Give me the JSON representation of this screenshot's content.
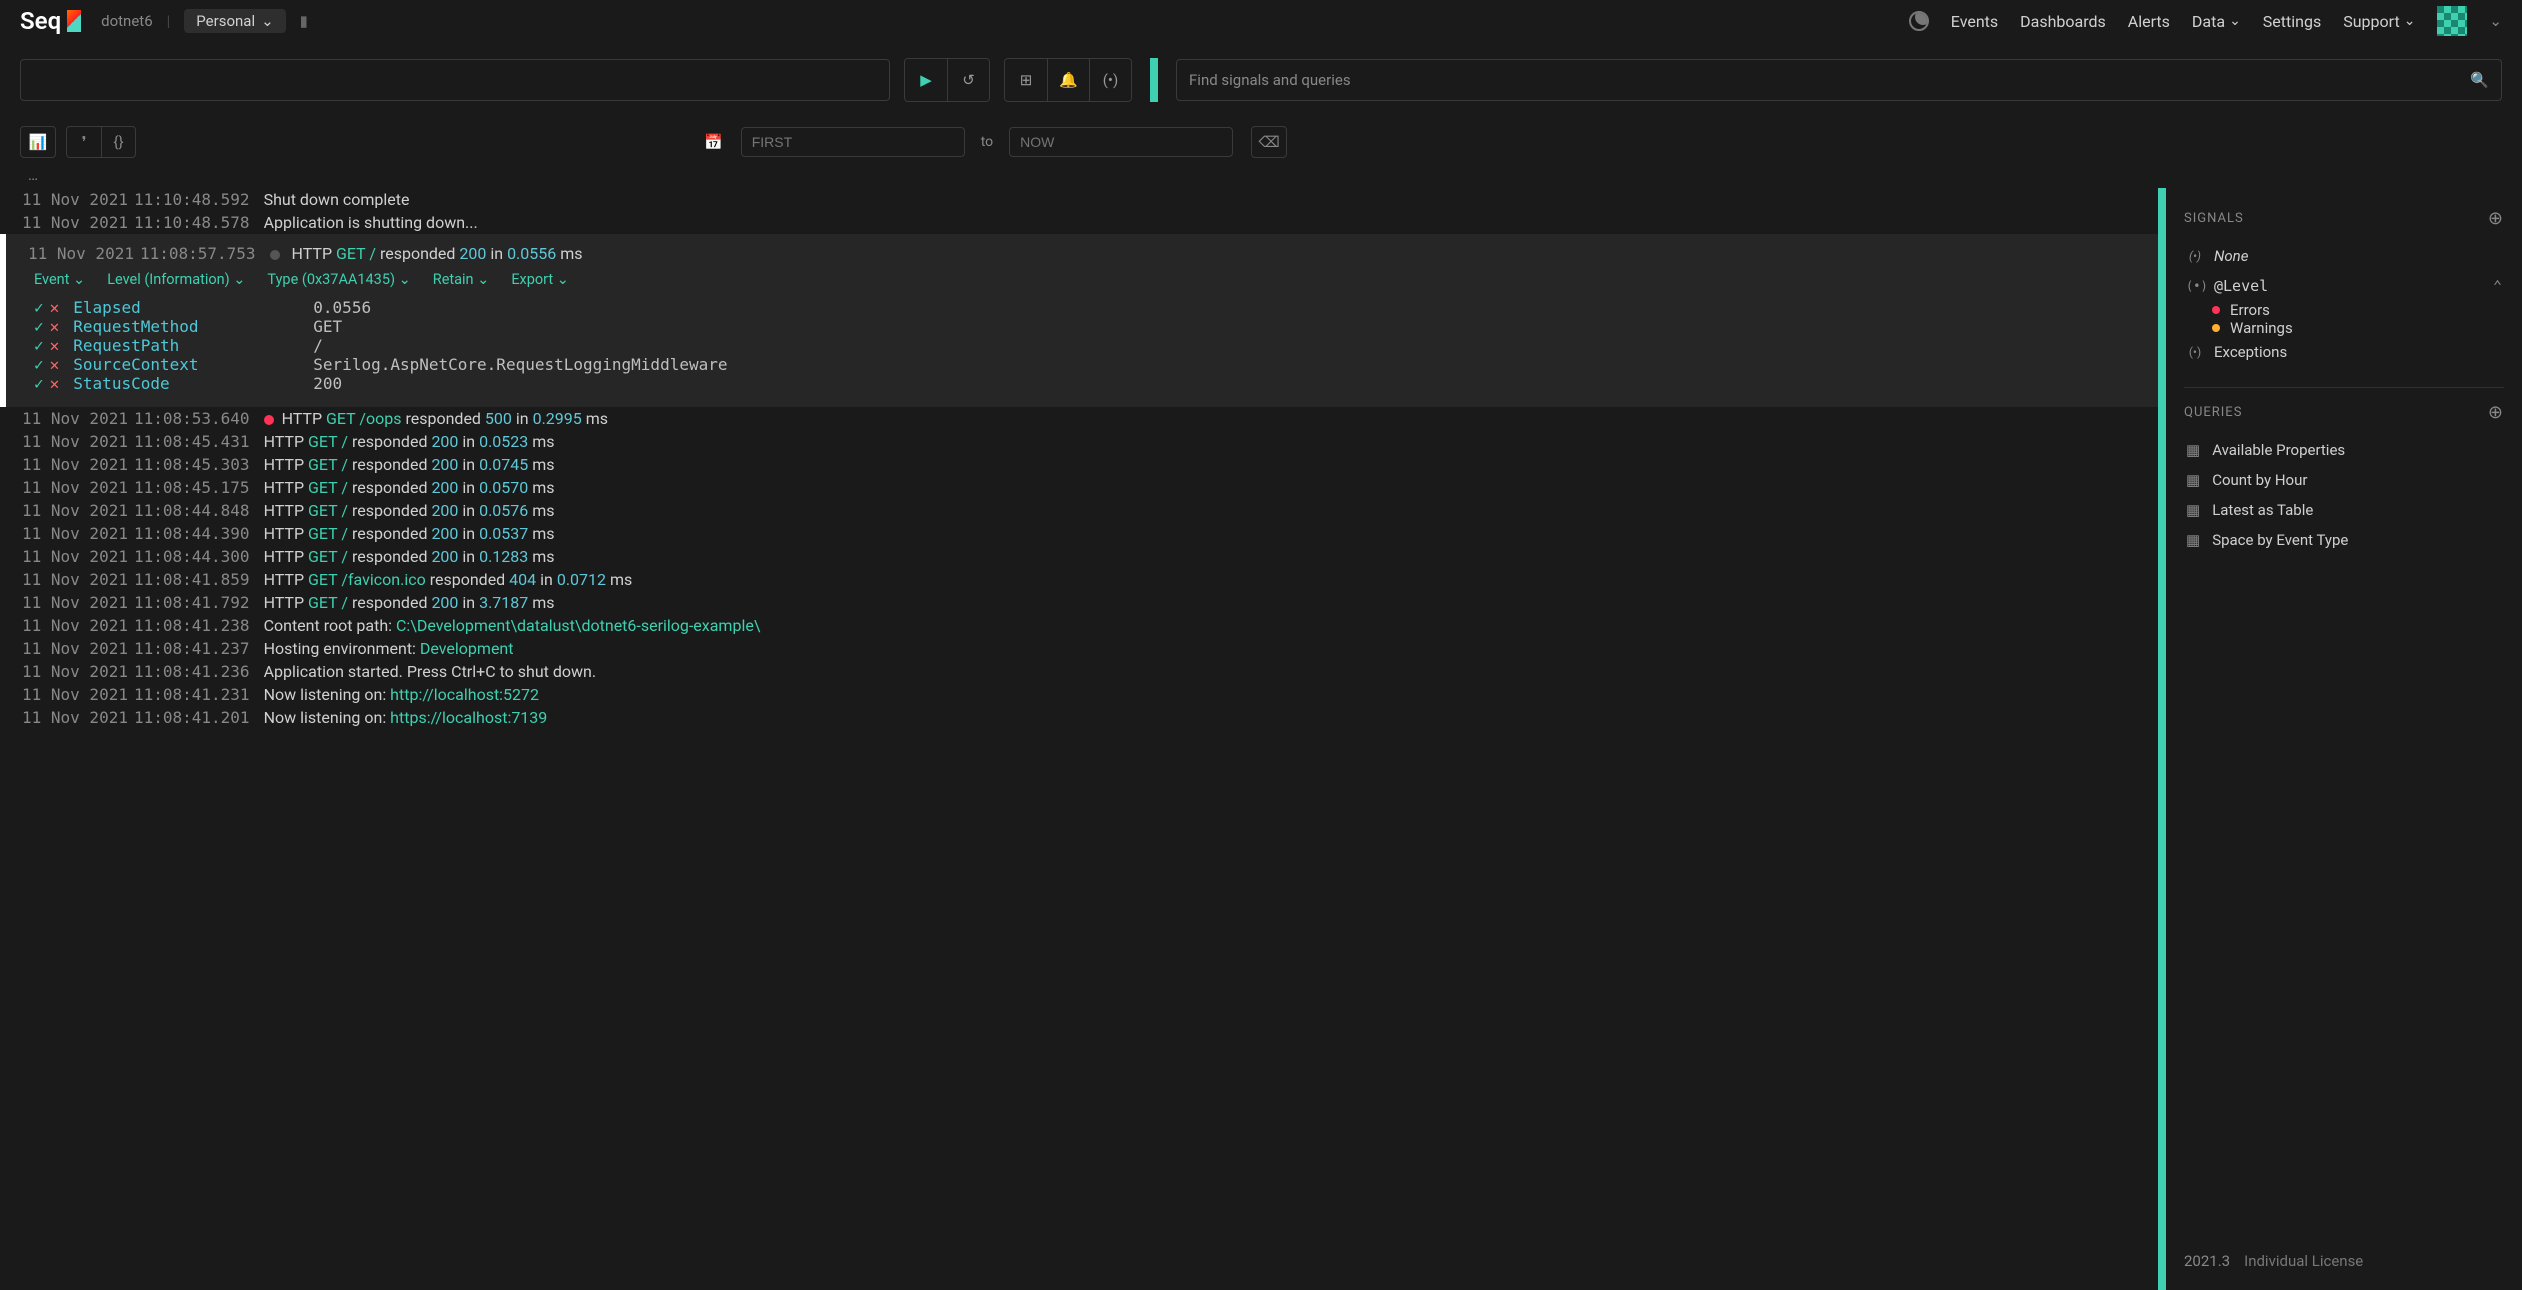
{
  "brand": "Seq",
  "project": "dotnet6",
  "workspace": "Personal",
  "nav": {
    "events": "Events",
    "dashboards": "Dashboards",
    "alerts": "Alerts",
    "data": "Data",
    "settings": "Settings",
    "support": "Support"
  },
  "signals_search_placeholder": "Find signals and queries",
  "secondary": {
    "from_placeholder": "FIRST",
    "to_label": "to",
    "to_placeholder": "NOW",
    "ellipsis": "…"
  },
  "events": [
    {
      "date": "11 Nov 2021",
      "time": "11:10:48.592",
      "msg_plain": "Shut down complete"
    },
    {
      "date": "11 Nov 2021",
      "time": "11:10:48.578",
      "msg_plain": "Application is shutting down..."
    },
    {
      "date": "11 Nov 2021",
      "time": "11:08:57.753",
      "dot": "grey",
      "expanded": true,
      "msg_parts": {
        "prefix": "HTTP ",
        "method": "GET",
        "path": " /",
        "mid": " responded ",
        "code": "200",
        "in": " in ",
        "elapsed": "0.0556",
        "unit": " ms"
      },
      "menu": {
        "event": "Event",
        "level": "Level (Information)",
        "type": "Type (0x37AA1435)",
        "retain": "Retain",
        "export": "Export"
      },
      "props": [
        {
          "k": "Elapsed",
          "v": "0.0556"
        },
        {
          "k": "RequestMethod",
          "v": "GET"
        },
        {
          "k": "RequestPath",
          "v": "/"
        },
        {
          "k": "SourceContext",
          "v": "Serilog.AspNetCore.RequestLoggingMiddleware"
        },
        {
          "k": "StatusCode",
          "v": "200"
        }
      ]
    },
    {
      "date": "11 Nov 2021",
      "time": "11:08:53.640",
      "dot": "red",
      "msg_parts": {
        "prefix": "HTTP ",
        "method": "GET",
        "path": " /oops",
        "mid": " responded ",
        "code": "500",
        "in": " in ",
        "elapsed": "0.2995",
        "unit": " ms"
      }
    },
    {
      "date": "11 Nov 2021",
      "time": "11:08:45.431",
      "msg_parts": {
        "prefix": "HTTP ",
        "method": "GET",
        "path": " /",
        "mid": " responded ",
        "code": "200",
        "in": " in ",
        "elapsed": "0.0523",
        "unit": " ms"
      }
    },
    {
      "date": "11 Nov 2021",
      "time": "11:08:45.303",
      "msg_parts": {
        "prefix": "HTTP ",
        "method": "GET",
        "path": " /",
        "mid": " responded ",
        "code": "200",
        "in": " in ",
        "elapsed": "0.0745",
        "unit": " ms"
      }
    },
    {
      "date": "11 Nov 2021",
      "time": "11:08:45.175",
      "msg_parts": {
        "prefix": "HTTP ",
        "method": "GET",
        "path": " /",
        "mid": " responded ",
        "code": "200",
        "in": " in ",
        "elapsed": "0.0570",
        "unit": " ms"
      }
    },
    {
      "date": "11 Nov 2021",
      "time": "11:08:44.848",
      "msg_parts": {
        "prefix": "HTTP ",
        "method": "GET",
        "path": " /",
        "mid": " responded ",
        "code": "200",
        "in": " in ",
        "elapsed": "0.0576",
        "unit": " ms"
      }
    },
    {
      "date": "11 Nov 2021",
      "time": "11:08:44.390",
      "msg_parts": {
        "prefix": "HTTP ",
        "method": "GET",
        "path": " /",
        "mid": " responded ",
        "code": "200",
        "in": " in ",
        "elapsed": "0.0537",
        "unit": " ms"
      }
    },
    {
      "date": "11 Nov 2021",
      "time": "11:08:44.300",
      "msg_parts": {
        "prefix": "HTTP ",
        "method": "GET",
        "path": " /",
        "mid": " responded ",
        "code": "200",
        "in": " in ",
        "elapsed": "0.1283",
        "unit": " ms"
      }
    },
    {
      "date": "11 Nov 2021",
      "time": "11:08:41.859",
      "msg_parts": {
        "prefix": "HTTP ",
        "method": "GET",
        "path": " /favicon.ico",
        "mid": " responded ",
        "code": "404",
        "in": " in ",
        "elapsed": "0.0712",
        "unit": " ms"
      }
    },
    {
      "date": "11 Nov 2021",
      "time": "11:08:41.792",
      "msg_parts": {
        "prefix": "HTTP ",
        "method": "GET",
        "path": " /",
        "mid": " responded ",
        "code": "200",
        "in": " in ",
        "elapsed": "3.7187",
        "unit": " ms"
      }
    },
    {
      "date": "11 Nov 2021",
      "time": "11:08:41.238",
      "msg_rich": {
        "pre": "Content root path: ",
        "hl": "C:\\Development\\datalust\\dotnet6-serilog-example\\"
      }
    },
    {
      "date": "11 Nov 2021",
      "time": "11:08:41.237",
      "msg_rich": {
        "pre": "Hosting environment: ",
        "hl": "Development"
      }
    },
    {
      "date": "11 Nov 2021",
      "time": "11:08:41.236",
      "msg_plain": "Application started. Press Ctrl+C to shut down."
    },
    {
      "date": "11 Nov 2021",
      "time": "11:08:41.231",
      "msg_rich": {
        "pre": "Now listening on: ",
        "hl": "http://localhost:5272"
      }
    },
    {
      "date": "11 Nov 2021",
      "time": "11:08:41.201",
      "msg_rich": {
        "pre": "Now listening on: ",
        "hl": "https://localhost:7139"
      }
    }
  ],
  "sidepanel": {
    "signals_header": "SIGNALS",
    "none": "None",
    "level": "@Level",
    "errors": "Errors",
    "warnings": "Warnings",
    "exceptions": "Exceptions",
    "queries_header": "QUERIES",
    "queries": [
      "Available Properties",
      "Count by Hour",
      "Latest as Table",
      "Space by Event Type"
    ],
    "version": "2021.3",
    "license": "Individual License"
  }
}
